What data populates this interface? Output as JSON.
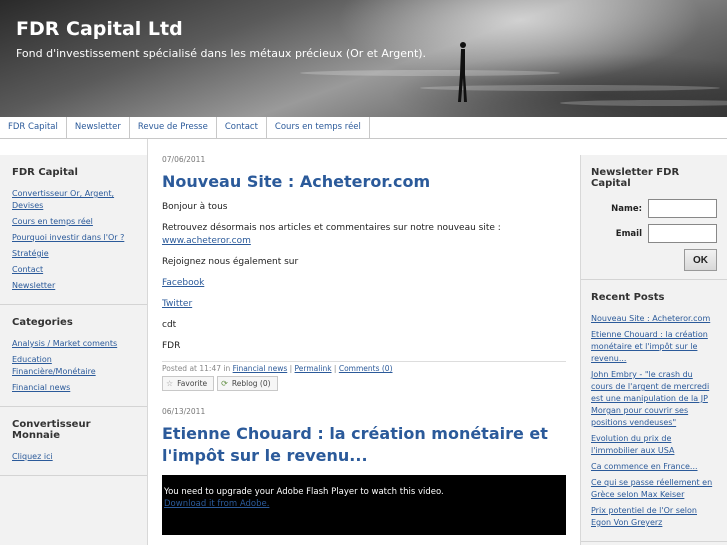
{
  "site": {
    "title": "FDR Capital Ltd",
    "description": "Fond d'investissement spécialisé dans les métaux précieux (Or et Argent)."
  },
  "nav": [
    "FDR Capital",
    "Newsletter",
    "Revue de Presse",
    "Contact",
    "Cours en temps réel"
  ],
  "left_sidebar": {
    "fdr": {
      "title": "FDR Capital",
      "links": [
        "Convertisseur Or, Argent, Devises",
        "Cours en temps réel",
        "Pourquoi investir dans l'Or ?",
        "Stratégie",
        "Contact",
        "Newsletter"
      ]
    },
    "categories": {
      "title": "Categories",
      "links": [
        "Analysis / Market coments",
        "Education Financière/Monétaire",
        "Financial news"
      ]
    },
    "convertisseur": {
      "title": "Convertisseur Monnaie",
      "links": [
        "Cliquez ici"
      ]
    }
  },
  "posts": [
    {
      "date": "07/06/2011",
      "title": "Nouveau Site : Acheteror.com",
      "p1": "Bonjour à tous",
      "p2": "Retrouvez désormais nos articles et commentaires sur notre nouveau site :",
      "p2_link": "www.acheteror.com",
      "p3": "Rejoignez nous également sur",
      "facebook": "Facebook",
      "twitter": "Twitter",
      "p4": "cdt",
      "p5": "FDR",
      "footer_prefix": "Posted at 11:47 in",
      "footer_category": "Financial news",
      "footer_permalink": "Permalink",
      "footer_comments": "Comments (0)",
      "favorite": "Favorite",
      "reblog": "Reblog (0)"
    },
    {
      "date": "06/13/2011",
      "title": "Etienne Chouard : la création monétaire et l'impôt sur le revenu...",
      "flash_text": "You need to upgrade your Adobe Flash Player to watch this video.",
      "flash_link": "Download it from Adobe."
    }
  ],
  "right_sidebar": {
    "newsletter": {
      "title": "Newsletter FDR Capital",
      "name_label": "Name:",
      "email_label": "Email",
      "ok": "OK"
    },
    "recent": {
      "title": "Recent Posts",
      "links": [
        "Nouveau Site : Acheteror.com",
        "Etienne Chouard : la création monétaire et l'impôt sur le revenu...",
        "John Embry - \"le crash du cours de l'argent de mercredi est une manipulation de la JP Morgan pour couvrir ses positions vendeuses\"",
        "Evolution du prix de l'immobilier aux USA",
        "Ca commence en France...",
        "Ce qui se passe réellement en Grèce selon Max Keiser",
        "Prix potentiel de l'Or selon Egon Von Greyerz"
      ]
    }
  },
  "colors": {
    "link": "#2b5a9a",
    "sidebar_bg": "#f2f2f2"
  }
}
